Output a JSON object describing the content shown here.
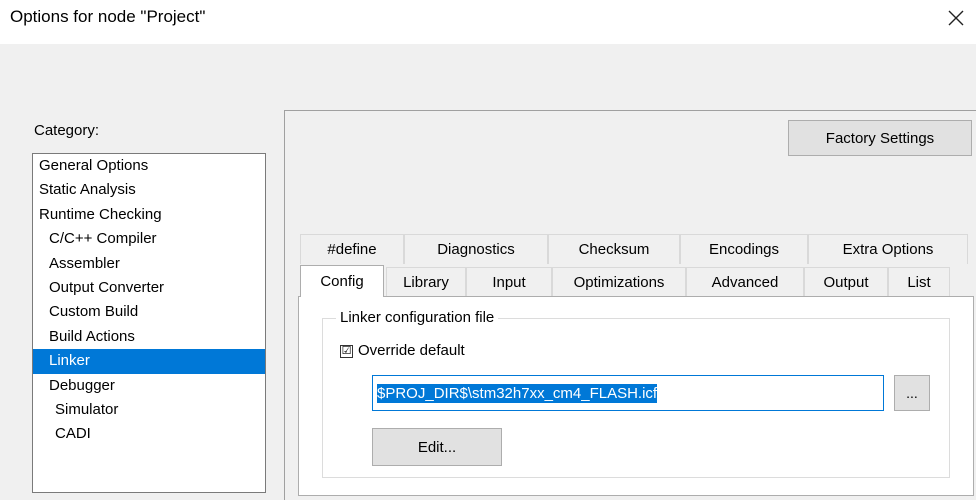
{
  "dialog": {
    "title": "Options for node \"Project\"",
    "close_icon": "close-icon"
  },
  "category": {
    "label": "Category:",
    "items": [
      {
        "label": "General Options",
        "level": 0
      },
      {
        "label": "Static Analysis",
        "level": 0
      },
      {
        "label": "Runtime Checking",
        "level": 0
      },
      {
        "label": "C/C++ Compiler",
        "level": 1
      },
      {
        "label": "Assembler",
        "level": 1
      },
      {
        "label": "Output Converter",
        "level": 1
      },
      {
        "label": "Custom Build",
        "level": 1
      },
      {
        "label": "Build Actions",
        "level": 1
      },
      {
        "label": "Linker",
        "level": 1,
        "selected": true
      },
      {
        "label": "Debugger",
        "level": 1
      },
      {
        "label": "Simulator",
        "level": 2
      },
      {
        "label": "CADI",
        "level": 2
      }
    ]
  },
  "factory_settings_label": "Factory Settings",
  "tabs_row1": [
    "#define",
    "Diagnostics",
    "Checksum",
    "Encodings",
    "Extra Options"
  ],
  "tabs_row2": [
    "Config",
    "Library",
    "Input",
    "Optimizations",
    "Advanced",
    "Output",
    "List"
  ],
  "active_tab": "Config",
  "config": {
    "group_title": "Linker configuration file",
    "override_label": "Override default",
    "override_checked": "☑",
    "path_value": "$PROJ_DIR$\\stm32h7xx_cm4_FLASH.icf",
    "browse_label": "...",
    "edit_label": "Edit..."
  },
  "colors": {
    "accent": "#0078d7",
    "background": "#f0f0f0"
  }
}
